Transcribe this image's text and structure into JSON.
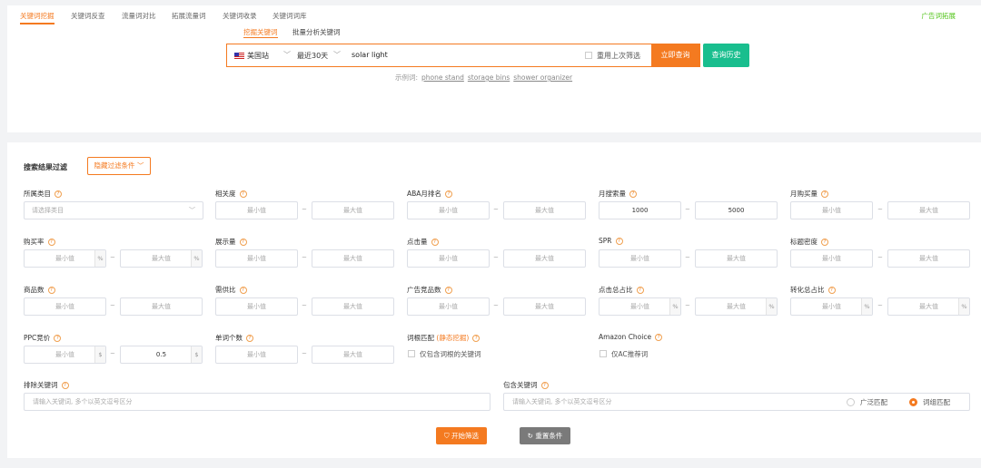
{
  "tabs": [
    "关键词挖掘",
    "关键词反查",
    "流量词对比",
    "拓展流量词",
    "关键词收录",
    "关键词词库"
  ],
  "top_right_link": "广告词拓展",
  "search": {
    "modes": [
      "挖掘关键词",
      "批量分析关键词"
    ],
    "site": "美国站",
    "period": "最近30天",
    "query": "solar  light",
    "reuse_label": "重用上次筛选",
    "query_button": "立即查询",
    "history_button": "查询历史",
    "examples_label": "示例词:",
    "examples": [
      "phone stand",
      "storage bins",
      "shower organizer"
    ]
  },
  "filters": {
    "title": "搜索结果过滤",
    "hide_button": "隐藏过滤条件",
    "min_placeholder": "最小值",
    "max_placeholder": "最大值",
    "dash": "~",
    "percent_unit": "%",
    "dollar_unit": "$",
    "category": {
      "label": "所属类目",
      "placeholder": "请选择类目"
    },
    "relevance": {
      "label": "相关度"
    },
    "aba_rank": {
      "label": "ABA月排名"
    },
    "monthly_search": {
      "label": "月搜索量",
      "min": "1000",
      "max": "5000"
    },
    "monthly_purchase": {
      "label": "月购买量"
    },
    "purchase_rate": {
      "label": "购买率"
    },
    "impressions": {
      "label": "展示量"
    },
    "clicks": {
      "label": "点击量"
    },
    "spr": {
      "label": "SPR"
    },
    "title_density": {
      "label": "标题密度"
    },
    "product_count": {
      "label": "商品数"
    },
    "supply_demand": {
      "label": "需供比"
    },
    "ad_products": {
      "label": "广告竞品数"
    },
    "click_share": {
      "label": "点击总占比"
    },
    "conversion_share": {
      "label": "转化总占比"
    },
    "ppc_bid": {
      "label": "PPC竞价",
      "max": "0.5"
    },
    "word_count": {
      "label": "单词个数"
    },
    "root_match": {
      "label_prefix": "词根匹配",
      "label_highlight": "(静态挖掘)",
      "checkbox_label": "仅包含词根的关键词"
    },
    "amazon_choice": {
      "label": "Amazon Choice",
      "checkbox_label": "仅AC推荐词"
    },
    "exclude_keywords": {
      "label": "排除关键词",
      "placeholder": "请输入关键词, 多个以英文逗号区分"
    },
    "include_keywords": {
      "label": "包含关键词",
      "placeholder": "请输入关键词, 多个以英文逗号区分"
    },
    "match_broad": "广泛匹配",
    "match_phrase": "词组匹配",
    "start_button": "开始筛选",
    "reset_button": "重置条件"
  }
}
